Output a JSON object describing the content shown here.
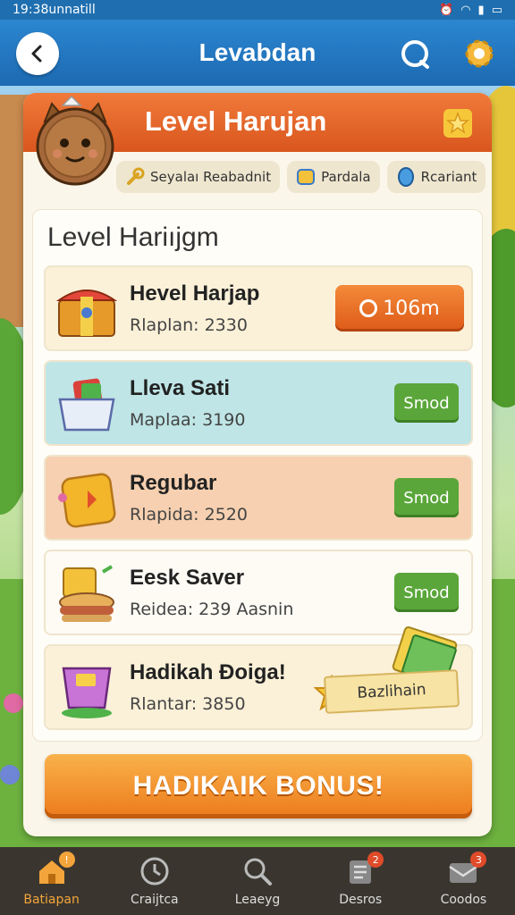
{
  "status_bar": {
    "time": "19:38unnatill"
  },
  "app_bar": {
    "title": "Levabdan"
  },
  "panel": {
    "title": "Level Harujan",
    "chips": [
      {
        "label": "Seyalaı Reabadnit",
        "icon": "wrench-icon"
      },
      {
        "label": "Pardala",
        "icon": "coin-icon"
      },
      {
        "label": "Rcariant",
        "icon": "gem-icon"
      }
    ],
    "list_heading": "Level Hariıjgm",
    "items": [
      {
        "name": "Hevel Harjap",
        "sub": "Rlaplan: 2330",
        "action": "106m",
        "icon": "treasure-chest-icon",
        "bg": "#fbf1d8"
      },
      {
        "name": "Lleva Sati",
        "sub": "Maplaa: 3190",
        "action": "Smod",
        "icon": "basket-icon",
        "bg": "#bfe5e6"
      },
      {
        "name": "Regubar",
        "sub": "Rlapida: 2520",
        "action": "Smod",
        "icon": "tag-icon",
        "bg": "#f6d0b0"
      },
      {
        "name": "Eesk Saver",
        "sub": "Reidea: 239 Aasnin",
        "action": "Smod",
        "icon": "sandwich-icon",
        "bg": "#fdfbf4"
      },
      {
        "name": "Hadikah Đoiga!",
        "sub": "Rlantar: 3850",
        "action": "Bazlihain",
        "icon": "cup-icon",
        "bg": "#fbf1d8"
      }
    ],
    "bonus_button": "HADIKAIK BONUS!"
  },
  "bottom_nav": [
    {
      "label": "Batiapan",
      "icon": "home-icon",
      "badge": "",
      "active": true
    },
    {
      "label": "Craijtca",
      "icon": "clock-icon",
      "badge": "",
      "active": false
    },
    {
      "label": "Leaeyg",
      "icon": "search-icon",
      "badge": "",
      "active": false
    },
    {
      "label": "Desros",
      "icon": "list-icon",
      "badge": "2",
      "active": false
    },
    {
      "label": "Coodos",
      "icon": "mail-icon",
      "badge": "3",
      "active": false
    }
  ],
  "colors": {
    "app_bar": "#1c6ab2",
    "header": "#e0602a",
    "green_button": "#5aa63a",
    "orange_button": "#ec7a1c",
    "nav_bg": "#3a362f"
  }
}
